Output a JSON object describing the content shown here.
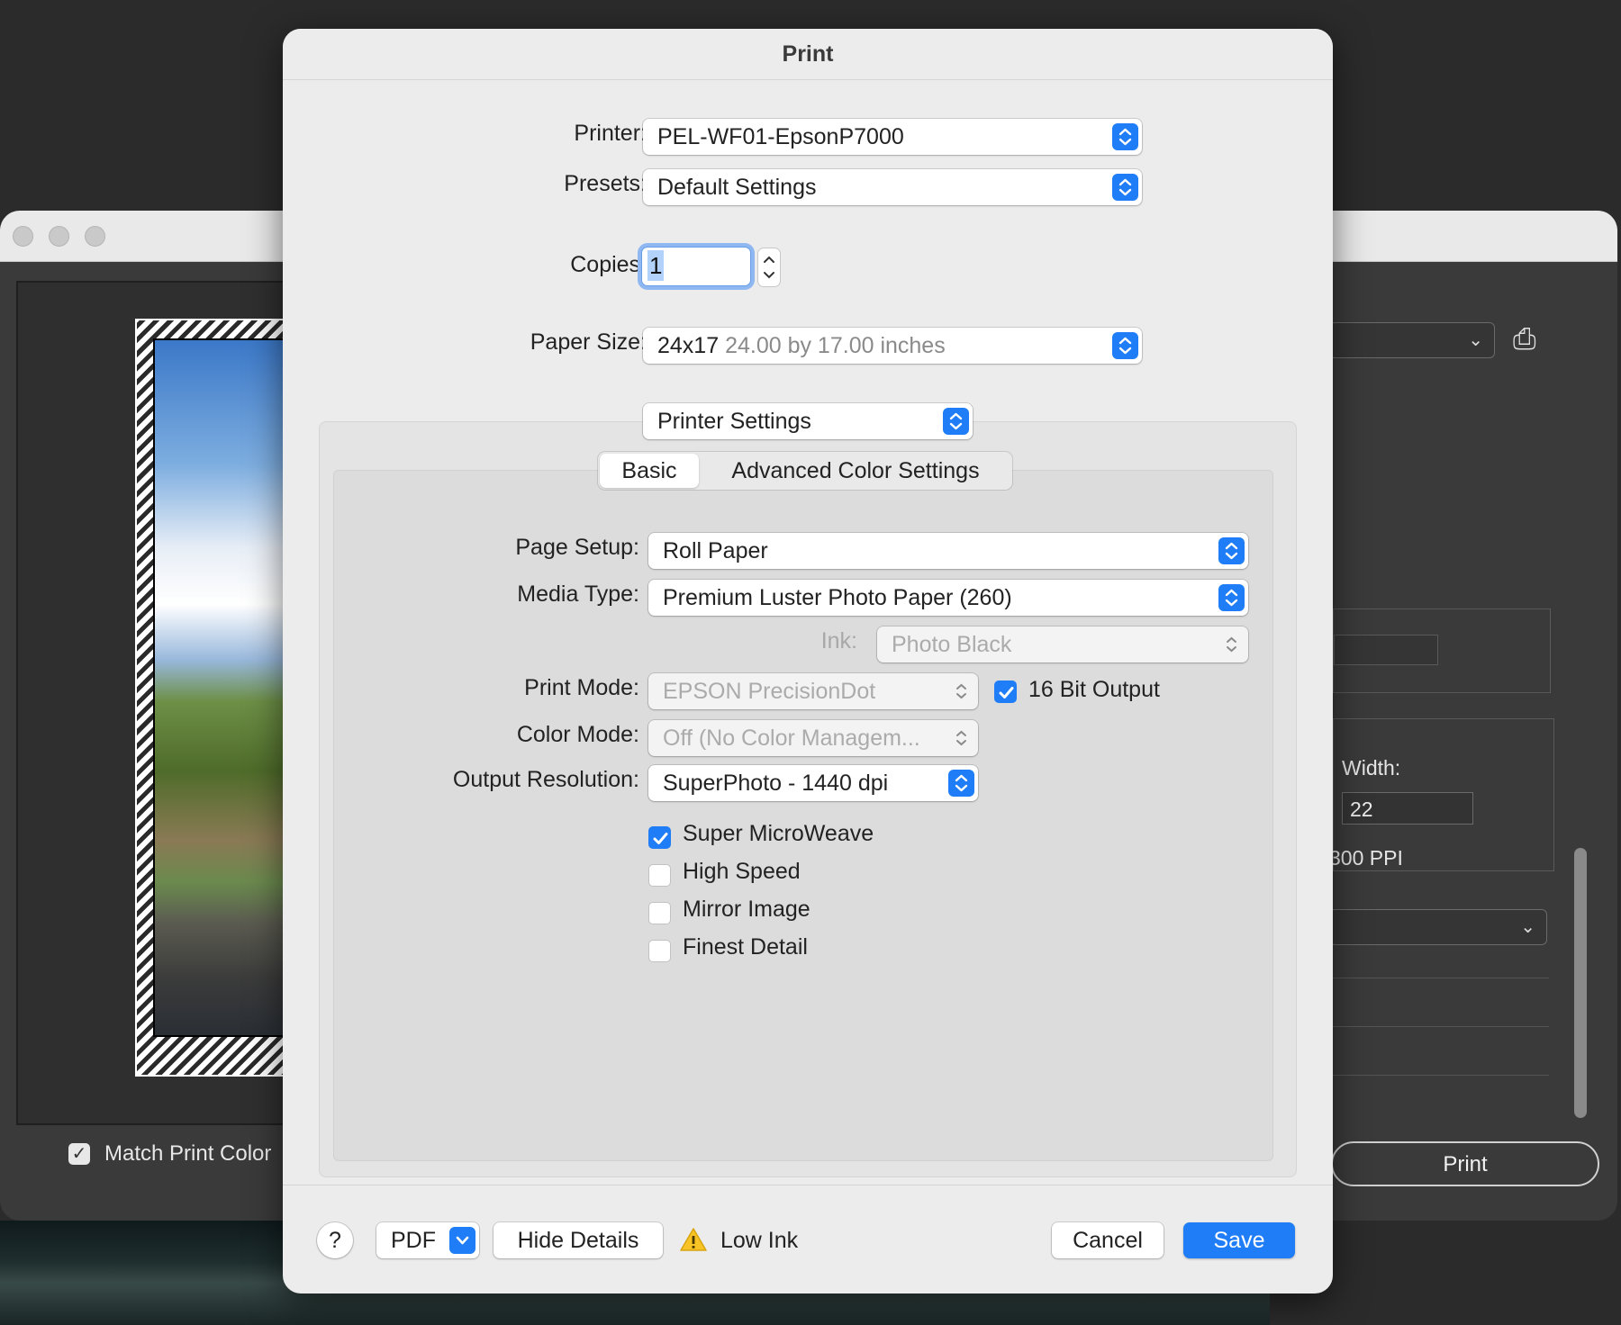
{
  "background_window": {
    "match_print_colors_label": "Match Print Color",
    "width_label": "Width:",
    "width_value": "22",
    "ppi_text": "300 PPI",
    "print_button": "Print"
  },
  "dialog": {
    "title": "Print",
    "printer": {
      "label": "Printer:",
      "value": "PEL-WF01-EpsonP7000"
    },
    "presets": {
      "label": "Presets:",
      "value": "Default Settings"
    },
    "copies": {
      "label": "Copies:",
      "value": "1"
    },
    "paper_size": {
      "label": "Paper Size:",
      "value": "24x17",
      "detail": "24.00 by 17.00 inches"
    },
    "section_popup": "Printer Settings",
    "tabs": [
      {
        "label": "Basic",
        "selected": true
      },
      {
        "label": "Advanced Color Settings",
        "selected": false
      }
    ],
    "page_setup": {
      "label": "Page Setup:",
      "value": "Roll Paper"
    },
    "media_type": {
      "label": "Media Type:",
      "value": "Premium Luster Photo Paper (260)"
    },
    "ink": {
      "label": "Ink:",
      "value": "Photo Black",
      "enabled": false
    },
    "print_mode": {
      "label": "Print Mode:",
      "value": "EPSON PrecisionDot",
      "enabled": false
    },
    "bit_output": {
      "label": "16 Bit Output",
      "checked": true
    },
    "color_mode": {
      "label": "Color Mode:",
      "value": "Off (No Color Managem...",
      "enabled": false
    },
    "output_resolution": {
      "label": "Output Resolution:",
      "value": "SuperPhoto - 1440 dpi"
    },
    "options": [
      {
        "label": "Super MicroWeave",
        "checked": true
      },
      {
        "label": "High Speed",
        "checked": false
      },
      {
        "label": "Mirror Image",
        "checked": false
      },
      {
        "label": "Finest Detail",
        "checked": false
      }
    ],
    "footer": {
      "help": "?",
      "pdf": "PDF",
      "hide_details": "Hide Details",
      "warning": "Low Ink",
      "cancel": "Cancel",
      "save": "Save"
    }
  },
  "colors": {
    "accent": "#1f7df7",
    "dialog_bg": "#ececec",
    "panel_bg": "#e2e2e2"
  },
  "icons": [
    "warning-icon",
    "chevron-down-icon",
    "updown-selector-icon",
    "help-icon",
    "printer-icon"
  ]
}
